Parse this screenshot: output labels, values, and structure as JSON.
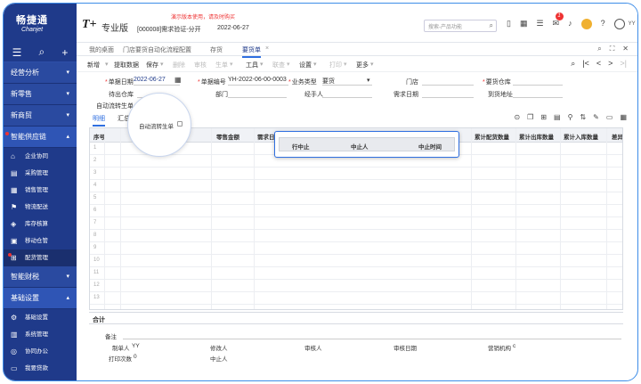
{
  "app": {
    "brand": "畅捷通",
    "brand_sub": "Chanjet",
    "product_mark": "T+",
    "edition": "专业版",
    "account": "[000008]需求验证-分开",
    "date": "2022-06-27",
    "demo_note": "演示版本使用，请及时购买"
  },
  "header": {
    "search_placeholder": "搜索-产品功能",
    "notify_count": "1",
    "user": "YY"
  },
  "sidebar": {
    "tools": [
      "☰",
      "⌕",
      "+"
    ],
    "groups_top": [
      {
        "label": "经营分析"
      },
      {
        "label": "新零售"
      },
      {
        "label": "新商贸"
      },
      {
        "label": "智能供应链"
      }
    ],
    "items": [
      {
        "label": "企业协同",
        "icon": "⌂"
      },
      {
        "label": "采购管理",
        "icon": "▤"
      },
      {
        "label": "销售管理",
        "icon": "▦"
      },
      {
        "label": "物流配送",
        "icon": "⚑"
      },
      {
        "label": "库存核算",
        "icon": "◈"
      },
      {
        "label": "移动仓管",
        "icon": "▣"
      },
      {
        "label": "配货管理",
        "icon": "⊞"
      }
    ],
    "groups_bottom": [
      {
        "label": "智能财税"
      },
      {
        "label": "基础设置"
      }
    ],
    "items2": [
      {
        "label": "基础设置",
        "icon": "⚙"
      },
      {
        "label": "系统管理",
        "icon": "▥"
      },
      {
        "label": "协同办公",
        "icon": "◎"
      },
      {
        "label": "我要贷款",
        "icon": "▭"
      }
    ]
  },
  "tabs": [
    {
      "label": "我的桌面"
    },
    {
      "label": "门店要货自动化流程配置"
    },
    {
      "label": "存货"
    },
    {
      "label": "要货单"
    }
  ],
  "toolbar": {
    "items": [
      "新增",
      "提取数据",
      "保存",
      "删除",
      "审核",
      "生单",
      "工具",
      "联查",
      "设置",
      "打印",
      "更多"
    ]
  },
  "form": {
    "date_label": "单据日期",
    "date_value": "2022-06-27",
    "code_label": "单据编号",
    "code_value": "YH-2022-06-00-0003",
    "biz_label": "业务类型",
    "biz_value": "要货",
    "store_label": "门店",
    "wh_label": "要货仓库",
    "outwh_label": "待出仓库",
    "dept_label": "部门",
    "handler_label": "经手人",
    "need_date_label": "需求日期",
    "addr_label": "到货地址",
    "auto_label": "自动流转生单"
  },
  "subtabs": [
    "明细",
    "汇总"
  ],
  "grid": {
    "headers": [
      "序号",
      "零售金额",
      "需求日",
      "累计配货数量",
      "累计出库数量",
      "累计入库数量",
      "差异"
    ],
    "rows": [
      "1",
      "2",
      "3",
      "4",
      "5",
      "6",
      "7",
      "8",
      "9",
      "10",
      "11",
      "12",
      "13"
    ]
  },
  "popup": {
    "headers": [
      "行中止",
      "中止人",
      "中止时间"
    ]
  },
  "lens": {
    "label": "自动流转生单"
  },
  "total": {
    "label": "合计"
  },
  "footer": {
    "remark": "备注",
    "maker_label": "制单人",
    "maker_value": "YY",
    "modifier_label": "修改人",
    "auditor_label": "审核人",
    "audit_date_label": "审核日期",
    "org_label": "营销机构",
    "org_value": "c",
    "print_label": "打印次数",
    "print_value": "0",
    "stop_label": "中止人"
  }
}
